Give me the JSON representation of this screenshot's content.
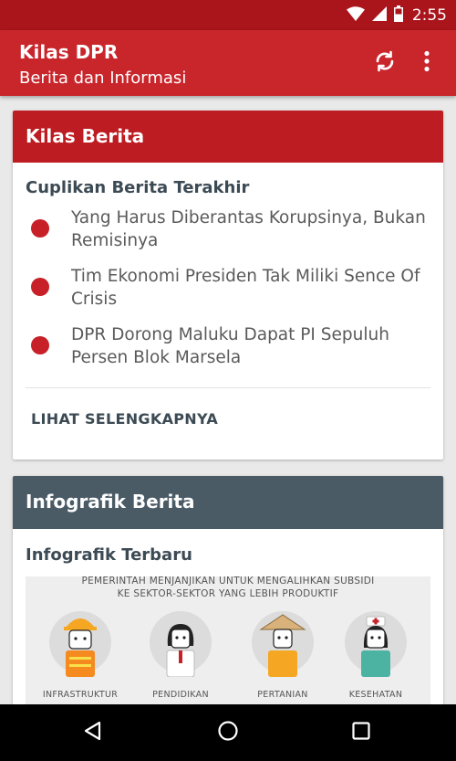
{
  "status_bar": {
    "time": "2:55",
    "icons": [
      "wifi-icon",
      "signal-icon",
      "battery-icon"
    ]
  },
  "app_bar": {
    "title": "Kilas DPR",
    "subtitle": "Berita dan Informasi",
    "actions": [
      "refresh-icon",
      "overflow-menu-icon"
    ]
  },
  "news_card": {
    "header": "Kilas Berita",
    "section_title": "Cuplikan Berita Terakhir",
    "items": [
      {
        "title": "Yang Harus Diberantas Korupsinya, Bukan Remisinya"
      },
      {
        "title": "Tim Ekonomi Presiden Tak Miliki Sence Of Crisis"
      },
      {
        "title": "DPR Dorong Maluku Dapat PI Sepuluh Persen Blok Marsela"
      }
    ],
    "more_label": "LIHAT SELENGKAPNYA",
    "bullet_color": "#c72029"
  },
  "info_card": {
    "header": "Infografik Berita",
    "section_title": "Infografik Terbaru",
    "infographic": {
      "title_line1": "PEMERINTAH MENJANJIKAN UNTUK MENGALIHKAN SUBSIDI",
      "title_line2": "KE SEKTOR-SEKTOR YANG LEBIH PRODUKTIF",
      "sectors": [
        {
          "label": "INFRASTRUKTUR",
          "icon": "construction-worker-icon"
        },
        {
          "label": "PENDIDIKAN",
          "icon": "student-icon"
        },
        {
          "label": "PERTANIAN",
          "icon": "farmer-icon"
        },
        {
          "label": "KESEHATAN",
          "icon": "nurse-icon"
        }
      ]
    }
  },
  "nav_bar": {
    "buttons": [
      "back-icon",
      "home-icon",
      "recents-icon"
    ]
  },
  "colors": {
    "status_bar": "#a9151b",
    "app_bar": "#c9262c",
    "news_header": "#bd1c22",
    "info_header": "#4a5b66",
    "section_text": "#3c4a54"
  }
}
